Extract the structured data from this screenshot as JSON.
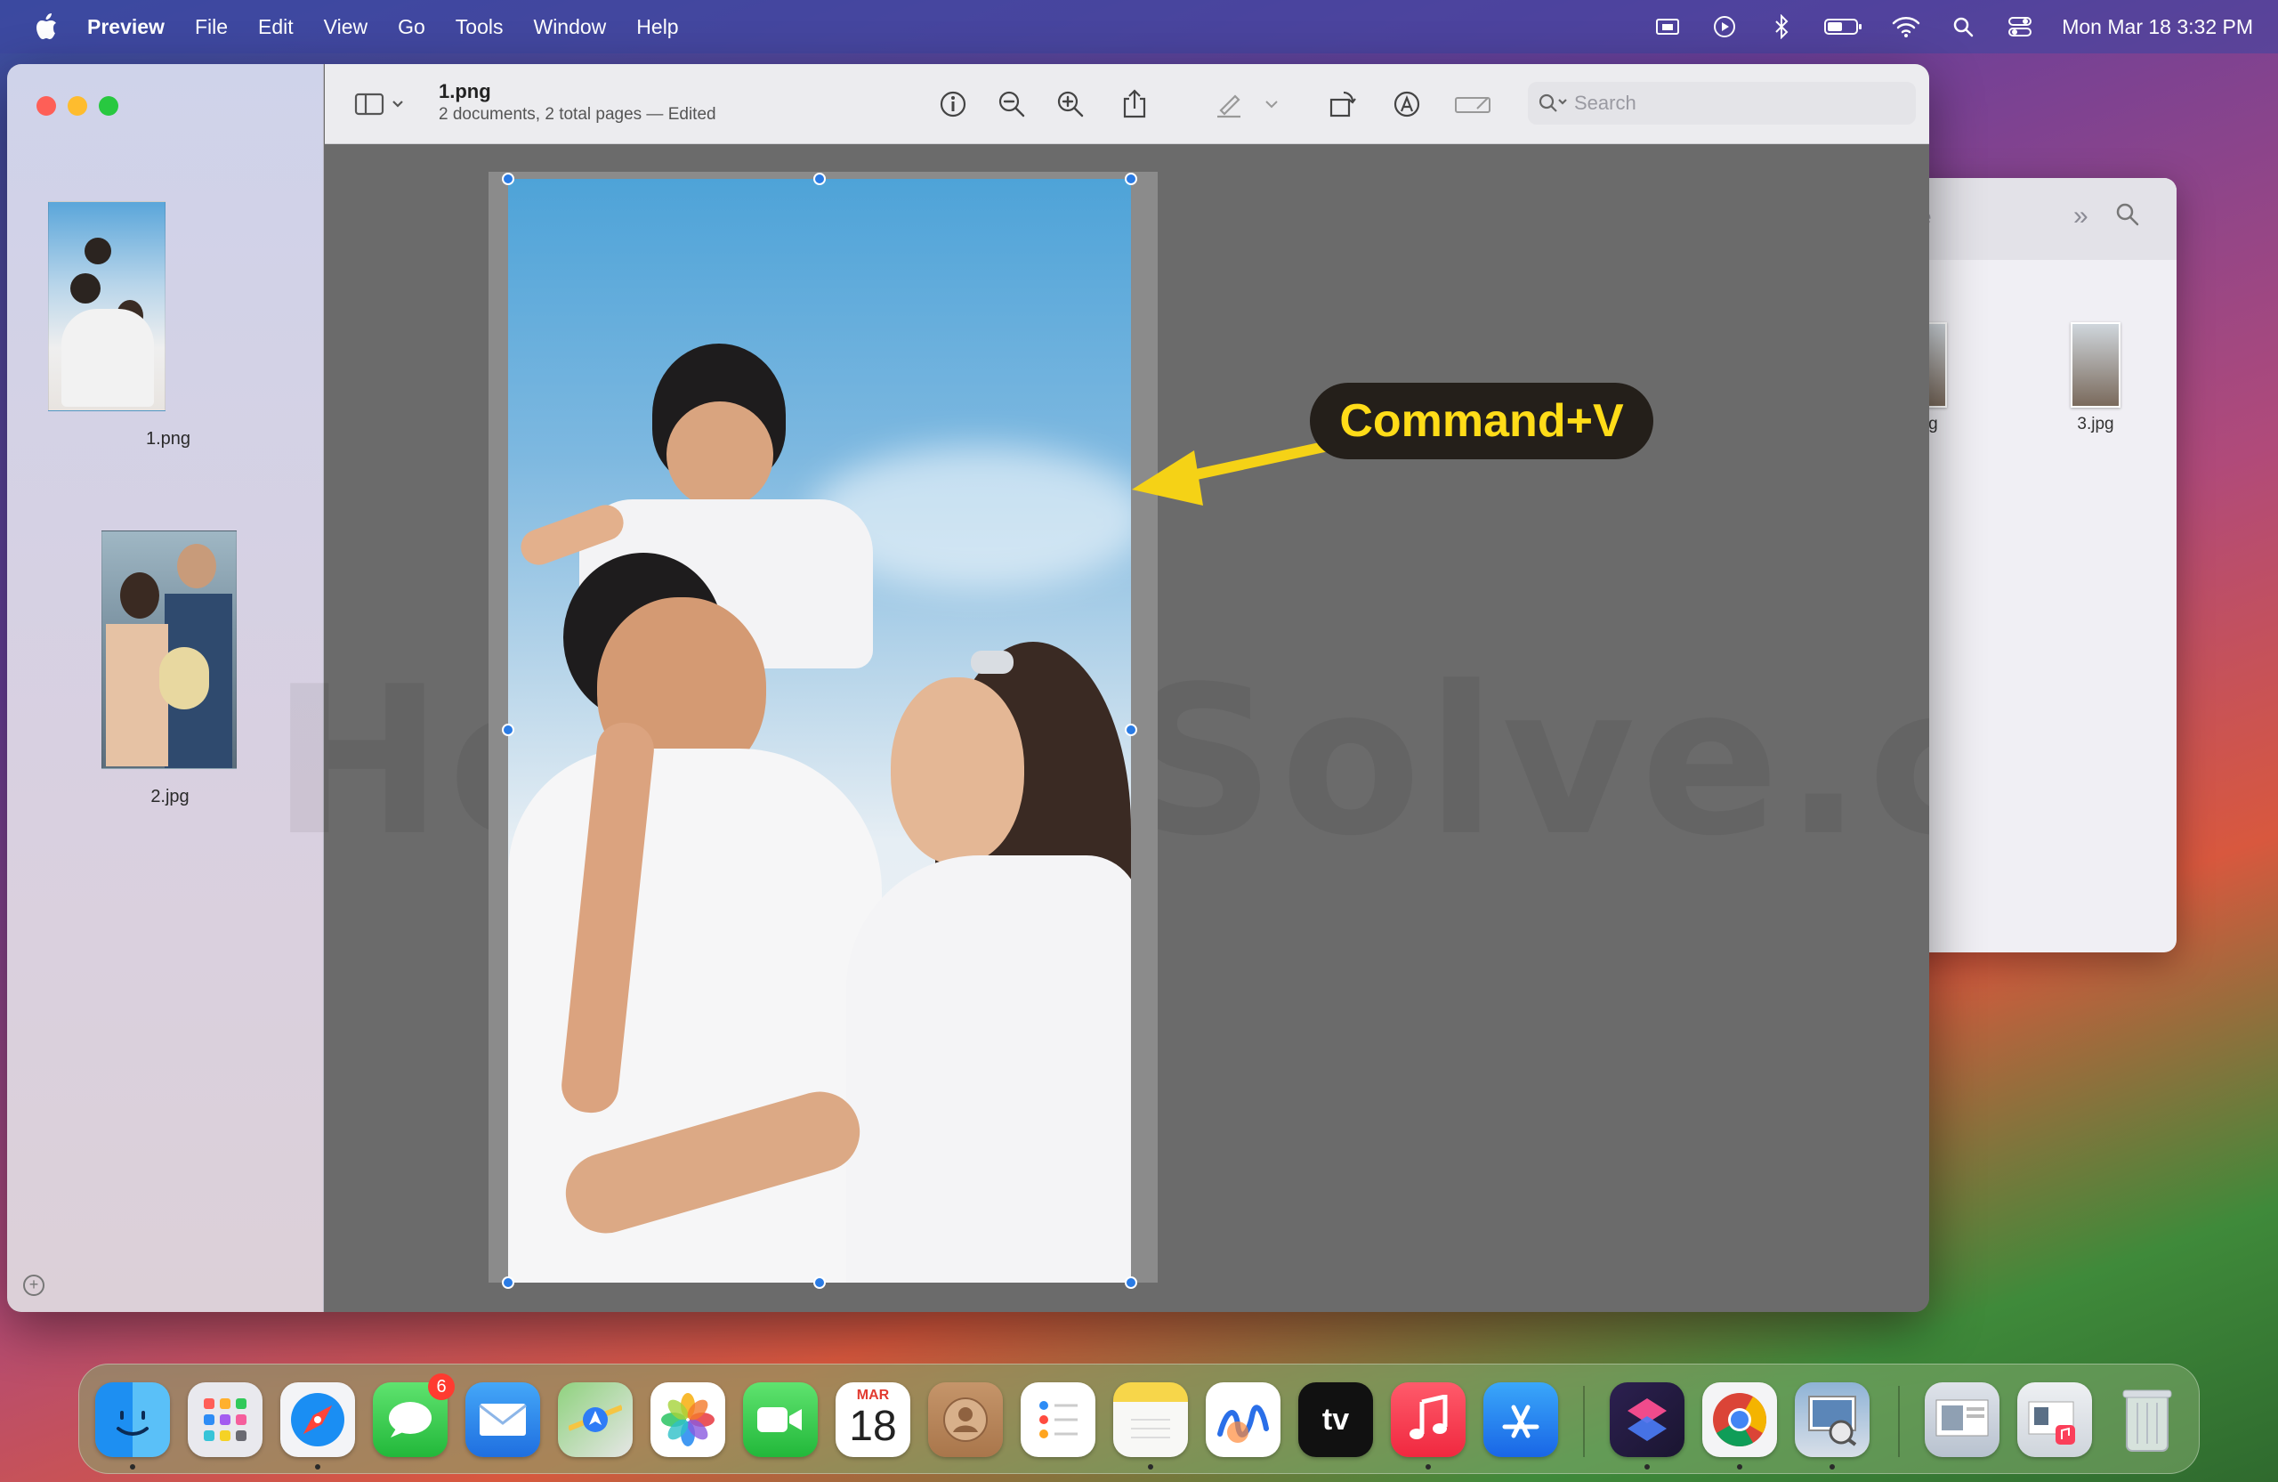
{
  "menubar": {
    "app_name": "Preview",
    "menus": [
      "File",
      "Edit",
      "View",
      "Go",
      "Tools",
      "Window",
      "Help"
    ],
    "clock": "Mon Mar 18  3:32 PM"
  },
  "preview": {
    "doc_title": "1.png",
    "doc_subtitle": "2 documents, 2 total pages — Edited",
    "search_placeholder": "Search",
    "sidebar": [
      {
        "label": "1.png"
      },
      {
        "label": "2.jpg"
      }
    ],
    "watermark": "HowToiSolve.com"
  },
  "finder": {
    "title_fragment": "ge",
    "items": [
      {
        "label": "jpg"
      },
      {
        "label": "3.jpg"
      }
    ]
  },
  "callout": {
    "text": "Command+V",
    "color": "#ffdc18"
  },
  "dock": {
    "messages_badge": "6",
    "calendar_month": "MAR",
    "calendar_day": "18",
    "appletv_label": "tv"
  }
}
